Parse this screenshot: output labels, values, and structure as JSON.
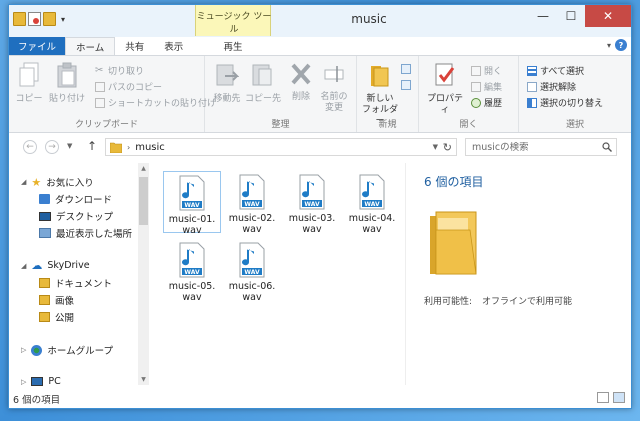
{
  "window": {
    "title": "music"
  },
  "contextual_tab": {
    "group_label": "ミュージック ツール",
    "tab_label": "再生"
  },
  "tabs": [
    {
      "label": "ファイル"
    },
    {
      "label": "ホーム"
    },
    {
      "label": "共有"
    },
    {
      "label": "表示"
    }
  ],
  "ribbon": {
    "clipboard": {
      "label": "クリップボード",
      "copy": "コピー",
      "paste": "貼り付け",
      "cut": "切り取り",
      "copy_path": "パスのコピー",
      "paste_shortcut": "ショートカットの貼り付け"
    },
    "organize": {
      "label": "整理",
      "move_to": "移動先",
      "copy_to": "コピー先",
      "delete": "削除",
      "rename_1": "名前の",
      "rename_2": "変更"
    },
    "new": {
      "label": "新規",
      "new_folder_1": "新しい",
      "new_folder_2": "フォルダー"
    },
    "open": {
      "label": "開く",
      "properties": "プロパティ",
      "open": "開く",
      "edit": "編集",
      "history": "履歴"
    },
    "select": {
      "label": "選択",
      "select_all": "すべて選択",
      "select_none": "選択解除",
      "invert": "選択の切り替え"
    }
  },
  "address": {
    "path": "music",
    "search_placeholder": "musicの検索"
  },
  "nav": {
    "favorites": "お気に入り",
    "downloads": "ダウンロード",
    "desktop": "デスクトップ",
    "recent": "最近表示した場所",
    "skydrive": "SkyDrive",
    "documents": "ドキュメント",
    "pictures": "画像",
    "public": "公開",
    "homegroup": "ホームグループ",
    "pc": "PC"
  },
  "files": [
    {
      "name_1": "music-01.",
      "name_2": "wav"
    },
    {
      "name_1": "music-02.",
      "name_2": "wav"
    },
    {
      "name_1": "music-03.",
      "name_2": "wav"
    },
    {
      "name_1": "music-04.",
      "name_2": "wav"
    },
    {
      "name_1": "music-05.",
      "name_2": "wav"
    },
    {
      "name_1": "music-06.",
      "name_2": "wav"
    }
  ],
  "preview": {
    "count_title": "6 個の項目",
    "availability_label": "利用可能性:",
    "availability_value": "オフラインで利用可能"
  },
  "status": {
    "item_count": "6 個の項目"
  },
  "colors": {
    "accent": "#1f6fbf",
    "context_tab": "#fbf7b9",
    "close_button": "#c74a45",
    "folder": "#e8b93a"
  }
}
